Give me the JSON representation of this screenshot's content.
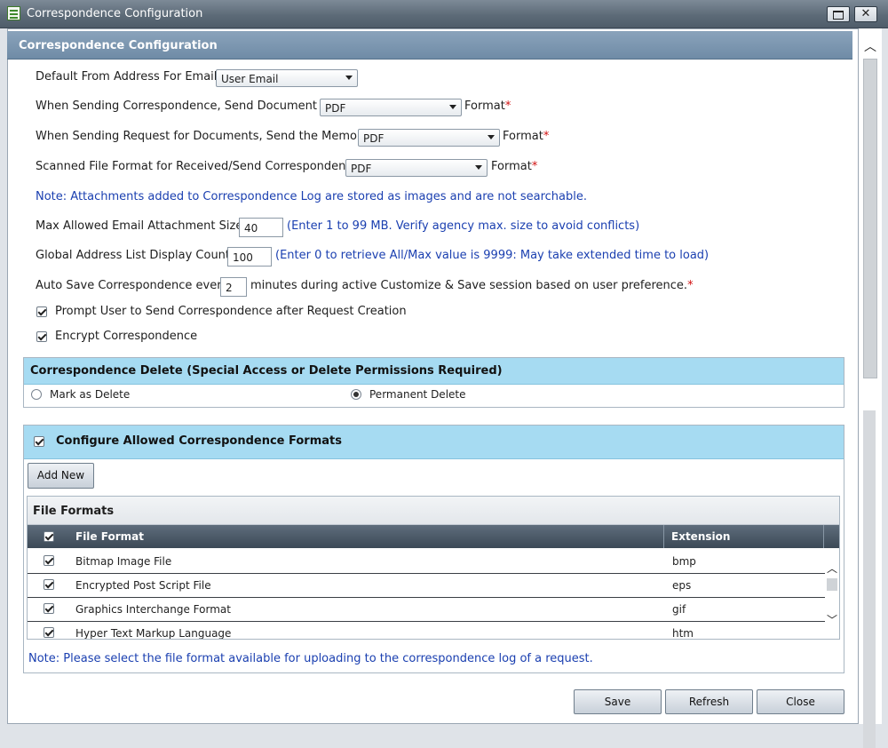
{
  "window": {
    "title": "Correspondence Configuration"
  },
  "header": {
    "title": "Correspondence Configuration"
  },
  "form": {
    "default_from": {
      "label": "Default From Address For Email",
      "value": "User Email"
    },
    "send_doc": {
      "label": "When Sending Correspondence, Send Document in",
      "value": "PDF",
      "suffix": "Format"
    },
    "send_memo": {
      "label": "When Sending Request for Documents, Send the Memo in",
      "value": "PDF",
      "suffix": "Format"
    },
    "scanned": {
      "label": "Scanned File Format for Received/Send Correspondence",
      "value": "PDF",
      "suffix": "Format"
    },
    "note_attachments": "Note: Attachments added to Correspondence Log are stored as images and are not searchable.",
    "max_attachment": {
      "label": "Max Allowed Email Attachment Size",
      "value": "40",
      "hint": "(Enter 1 to 99 MB. Verify agency max. size to avoid conflicts)"
    },
    "gal_count": {
      "label": "Global Address List Display Count",
      "value": "100",
      "hint": "(Enter 0 to retrieve All/Max value is 9999: May take extended time to load)"
    },
    "autosave": {
      "label_pre": "Auto Save Correspondence every",
      "value": "2",
      "label_post": "minutes during active Customize & Save session based on user preference."
    },
    "prompt_user": {
      "label": "Prompt User to Send Correspondence after Request Creation",
      "checked": true
    },
    "encrypt": {
      "label": "Encrypt Correspondence",
      "checked": true
    }
  },
  "delete_panel": {
    "title": "Correspondence Delete (Special Access or Delete Permissions Required)",
    "options": [
      {
        "label": "Mark as Delete",
        "selected": false
      },
      {
        "label": "Permanent Delete",
        "selected": true
      }
    ]
  },
  "formats_panel": {
    "title": "Configure Allowed Correspondence Formats",
    "checked": true,
    "add_new": "Add New",
    "grid_caption": "File Formats",
    "columns": [
      "File Format",
      "Extension"
    ],
    "rows": [
      {
        "name": "Bitmap Image File",
        "ext": "bmp",
        "checked": true
      },
      {
        "name": "Encrypted Post Script File",
        "ext": "eps",
        "checked": true
      },
      {
        "name": "Graphics Interchange Format",
        "ext": "gif",
        "checked": true
      },
      {
        "name": "Hyper Text Markup Language",
        "ext": "htm",
        "checked": true
      }
    ],
    "note": "Note: Please select the file format available for uploading to the correspondence log of a request."
  },
  "footer": {
    "save": "Save",
    "refresh": "Refresh",
    "close": "Close"
  },
  "colors": {
    "header_band": "#7a93ac",
    "panel_head": "#a6dbf2",
    "note_text": "#1a3fb0",
    "required": "#d01010"
  }
}
